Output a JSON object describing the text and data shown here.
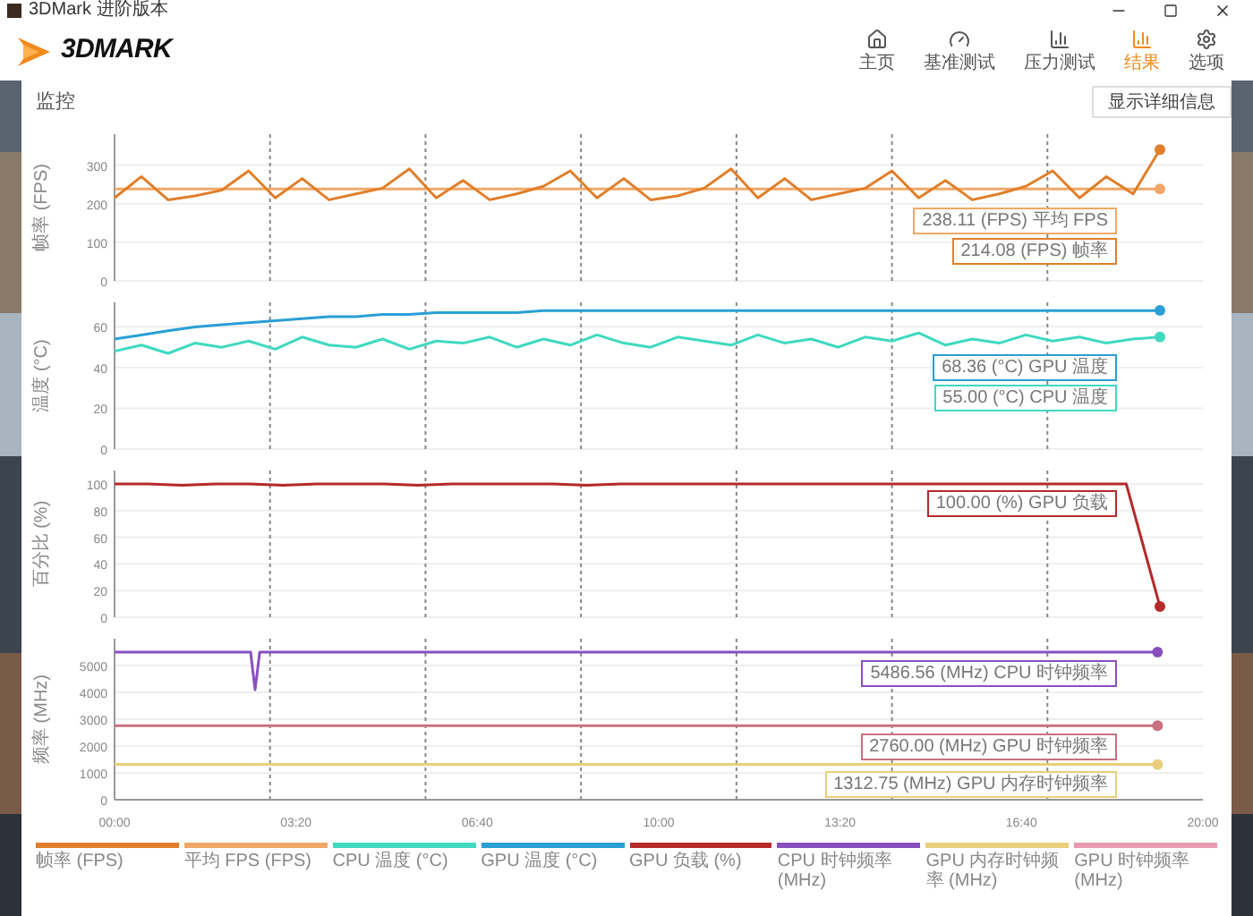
{
  "window": {
    "title": "3DMark 进阶版本"
  },
  "app": {
    "logo": "3DMARK"
  },
  "nav": [
    {
      "label": "主页",
      "selected": false
    },
    {
      "label": "基准测试",
      "selected": false
    },
    {
      "label": "压力测试",
      "selected": false
    },
    {
      "label": "结果",
      "selected": true
    },
    {
      "label": "选项",
      "selected": false
    }
  ],
  "monitor": {
    "title": "监控",
    "detail_button": "显示详细信息",
    "panels": [
      {
        "chart_data": {
          "type": "line",
          "ylabel": "帧率 (FPS)",
          "grid": true,
          "ylim": [
            0,
            380
          ],
          "yticks": [
            0,
            100,
            200,
            300
          ],
          "series": [
            {
              "color": "#f0a868",
              "values": [
                238,
                238,
                238,
                238,
                238,
                238,
                238,
                238,
                238,
                238,
                238,
                238,
                238,
                238,
                238,
                238,
                238,
                238,
                238,
                238,
                238,
                238,
                238,
                238,
                238,
                238,
                238,
                238,
                238,
                238,
                238,
                238,
                238,
                238,
                238,
                238,
                238,
                238,
                238,
                238
              ]
            },
            {
              "color": "#e07f2a",
              "values": [
                215,
                270,
                210,
                220,
                235,
                285,
                215,
                265,
                210,
                225,
                240,
                290,
                215,
                260,
                210,
                225,
                245,
                285,
                215,
                265,
                210,
                220,
                240,
                290,
                215,
                265,
                210,
                225,
                240,
                285,
                215,
                260,
                210,
                225,
                245,
                285,
                215,
                270,
                225,
                340
              ]
            }
          ]
        },
        "tags": [
          "238.11 (FPS) 平均 FPS",
          "214.08 (FPS) 帧率"
        ]
      },
      {
        "chart_data": {
          "type": "line",
          "ylabel": "温度 (°C)",
          "grid": true,
          "ylim": [
            0,
            72
          ],
          "yticks": [
            0,
            20,
            40,
            60
          ],
          "series": [
            {
              "color": "#2a9fd6",
              "values": [
                54,
                56,
                58,
                60,
                61,
                62,
                63,
                64,
                65,
                65,
                66,
                66,
                67,
                67,
                67,
                67,
                68,
                68,
                68,
                68,
                68,
                68,
                68,
                68,
                68,
                68,
                68,
                68,
                68,
                68,
                68,
                68,
                68,
                68,
                68,
                68,
                68,
                68,
                68,
                68
              ]
            },
            {
              "color": "#3fd9c0",
              "values": [
                48,
                51,
                47,
                52,
                50,
                53,
                49,
                55,
                51,
                50,
                54,
                49,
                53,
                52,
                55,
                50,
                54,
                51,
                56,
                52,
                50,
                55,
                53,
                51,
                56,
                52,
                54,
                50,
                55,
                53,
                57,
                51,
                54,
                52,
                56,
                53,
                55,
                52,
                54,
                55
              ]
            }
          ]
        },
        "tags": [
          "68.36 (°C) GPU 温度",
          "55.00 (°C) CPU 温度"
        ]
      },
      {
        "chart_data": {
          "type": "line",
          "ylabel": "百分比 (%)",
          "grid": true,
          "ylim": [
            0,
            110
          ],
          "yticks": [
            0,
            20,
            40,
            60,
            80,
            100
          ],
          "series": [
            {
              "color": "#b52a2a",
              "values": [
                100,
                100,
                99,
                100,
                100,
                99,
                100,
                100,
                100,
                99,
                100,
                100,
                100,
                100,
                99,
                100,
                100,
                100,
                100,
                100,
                100,
                100,
                100,
                100,
                100,
                100,
                100,
                100,
                100,
                100,
                100,
                8
              ]
            }
          ]
        },
        "tags": [
          "100.00 (%) GPU 负载"
        ]
      },
      {
        "chart_data": {
          "type": "line",
          "ylabel": "频率 (MHz)",
          "grid": true,
          "xlim": [
            0,
            1200
          ],
          "ylim": [
            0,
            6000
          ],
          "yticks": [
            0,
            1000,
            2000,
            3000,
            4000,
            5000
          ],
          "xticks": [
            {
              "value": 0,
              "label": "00:00"
            },
            {
              "value": 200,
              "label": "03:20"
            },
            {
              "value": 400,
              "label": "06:40"
            },
            {
              "value": 600,
              "label": "10:00"
            },
            {
              "value": 800,
              "label": "13:20"
            },
            {
              "value": 1000,
              "label": "16:40"
            },
            {
              "value": 1200,
              "label": "20:00"
            }
          ],
          "series": [
            {
              "color": "#8a4fbf",
              "x": [
                0,
                150,
                155,
                160,
                1150
              ],
              "values": [
                5500,
                5500,
                4100,
                5500,
                5500
              ]
            },
            {
              "color": "#c9707e",
              "x": [
                0,
                1150
              ],
              "values": [
                2760,
                2760
              ]
            },
            {
              "color": "#e8cf7a",
              "x": [
                0,
                1150
              ],
              "values": [
                1310,
                1310
              ]
            }
          ]
        },
        "tags": [
          "5486.56 (MHz) CPU 时钟频率",
          "2760.00 (MHz) GPU 时钟频率",
          "1312.75 (MHz) GPU 内存时钟频率"
        ]
      }
    ],
    "legend": [
      {
        "label": "帧率 (FPS)",
        "color": "#e07f2a"
      },
      {
        "label": "平均 FPS (FPS)",
        "color": "#f0a868"
      },
      {
        "label": "CPU 温度 (°C)",
        "color": "#3fd9c0"
      },
      {
        "label": "GPU 温度 (°C)",
        "color": "#2a9fd6"
      },
      {
        "label": "GPU 负载 (%)",
        "color": "#b52a2a"
      },
      {
        "label": "CPU 时钟频率 (MHz)",
        "color": "#8a4fbf"
      },
      {
        "label": "GPU 内存时钟频率 (MHz)",
        "color": "#e8cf7a"
      },
      {
        "label": "GPU 时钟频率 (MHz)",
        "color": "#e89ab0"
      }
    ]
  }
}
